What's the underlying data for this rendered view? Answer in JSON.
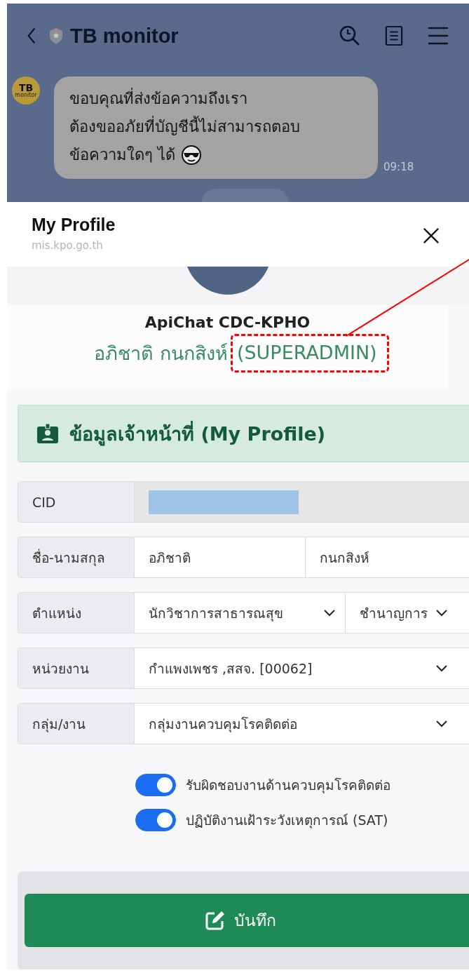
{
  "chat": {
    "title": "TB monitor",
    "sender_avatar": {
      "line1": "TB",
      "line2": "monitor"
    },
    "message": {
      "lines": [
        "ขอบคุณที่ส่งข้อความถึงเรา",
        "ต้องขออภัยที่บัญชีนี้ไม่สามารถตอบ",
        "ข้อความใดๆ ได้"
      ],
      "time": "09:18"
    }
  },
  "sheet": {
    "title": "My Profile",
    "url": "mis.kpo.go.th"
  },
  "profile": {
    "username": "ApiChat CDC-KPHO",
    "full_name": "อภิชาติ กนกสิงห์",
    "role": "(SUPERADMIN)"
  },
  "section_title": "ข้อมูลเจ้าหน้าที่ (My Profile)",
  "fields": [
    {
      "kind": "redacted",
      "label": "CID"
    },
    {
      "kind": "inputs",
      "label": "ชื่อ-นามสกุล",
      "values": [
        "อภิชาติ",
        "กนกสิงห์"
      ]
    },
    {
      "kind": "selects",
      "label": "ตำแหน่ง",
      "values": [
        "นักวิชาการสาธารณสุข",
        "ชำนาญการ"
      ]
    },
    {
      "kind": "selects",
      "label": "หน่วยงาน",
      "values": [
        "กำแพงเพชร ,สสจ. [00062]"
      ]
    },
    {
      "kind": "selects",
      "label": "กลุ่ม/งาน",
      "values": [
        "กลุ่มงานควบคุมโรคติดต่อ"
      ]
    }
  ],
  "toggles": [
    {
      "label": "รับผิดชอบงานด้านควบคุมโรคติดต่อ",
      "on": true
    },
    {
      "label": "ปฏิบัติงานเฝ้าระวังเหตุการณ์ (SAT)",
      "on": true
    }
  ],
  "save_button": "บันทึก"
}
